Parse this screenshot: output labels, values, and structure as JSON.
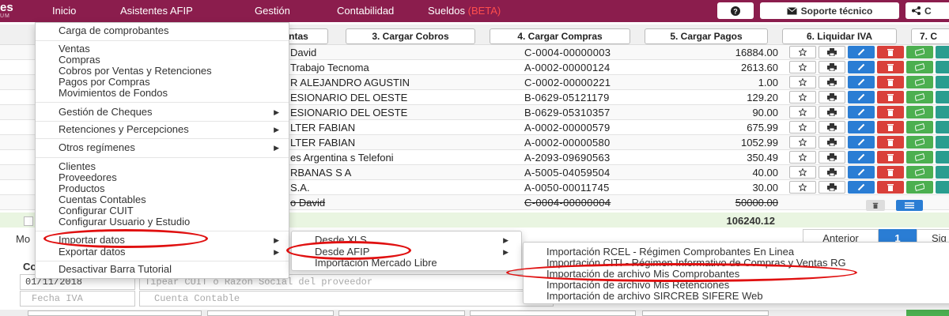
{
  "brand": {
    "main": "es",
    "sub": "UM"
  },
  "nav": {
    "items": [
      {
        "label": "Inicio"
      },
      {
        "label": "Asistentes AFIP"
      },
      {
        "label": "Gestión"
      },
      {
        "label": "Contabilidad"
      },
      {
        "label": "Sueldos"
      }
    ],
    "beta": "(BETA)",
    "support_label": "Soporte técnico",
    "share_label": "C"
  },
  "steps": [
    {
      "label": "ntas"
    },
    {
      "label": "3. Cargar Cobros"
    },
    {
      "label": "4. Cargar Compras"
    },
    {
      "label": "5. Cargar Pagos"
    },
    {
      "label": "6. Liquidar IVA"
    },
    {
      "label": "7. C"
    }
  ],
  "table": {
    "rows": [
      {
        "name": "David",
        "comprobante": "C-0004-00000003",
        "amount": "16884.00"
      },
      {
        "name": "Trabajo Tecnoma",
        "comprobante": "A-0002-00000124",
        "amount": "2613.60"
      },
      {
        "name": "R ALEJANDRO AGUSTIN",
        "comprobante": "C-0002-00000221",
        "amount": "1.00"
      },
      {
        "name": "ESIONARIO DEL OESTE",
        "comprobante": "B-0629-05121179",
        "amount": "129.20"
      },
      {
        "name": "ESIONARIO DEL OESTE",
        "comprobante": "B-0629-05310357",
        "amount": "90.00"
      },
      {
        "name": "LTER FABIAN",
        "comprobante": "A-0002-00000579",
        "amount": "675.99"
      },
      {
        "name": "LTER FABIAN",
        "comprobante": "A-0002-00000580",
        "amount": "1052.99"
      },
      {
        "name": "es Argentina s Telefoni",
        "comprobante": "A-2093-09690563",
        "amount": "350.49"
      },
      {
        "name": "RBANAS S A",
        "comprobante": "A-5005-04059504",
        "amount": "40.00"
      },
      {
        "name": "S.A.",
        "comprobante": "A-0050-00011745",
        "amount": "30.00"
      },
      {
        "name": "o David",
        "comprobante": "C-0004-00000004",
        "amount": "50000.00"
      }
    ],
    "total": "106240.12"
  },
  "pagination": {
    "prev": "Anterior",
    "current": "1",
    "next": "Sig"
  },
  "mo_label": "Mo",
  "form": {
    "label_c": "Co",
    "date_value": "01/11/2018",
    "provider_placeholder": "Tipear CUIT o Razón Social del proveedor",
    "fecha_iva_placeholder": "Fecha IVA",
    "cuenta_placeholder": "Cuenta Contable"
  },
  "menu1": {
    "items": [
      {
        "label": "Carga de comprobantes"
      },
      {
        "label": "Ventas"
      },
      {
        "label": "Compras"
      },
      {
        "label": "Cobros por Ventas y Retenciones"
      },
      {
        "label": "Pagos por Compras"
      },
      {
        "label": "Movimientos de Fondos"
      },
      {
        "label": "Gestión de Cheques"
      },
      {
        "label": "Retenciones y Percepciones"
      },
      {
        "label": "Otros regímenes"
      },
      {
        "label": "Clientes"
      },
      {
        "label": "Proveedores"
      },
      {
        "label": "Productos"
      },
      {
        "label": "Cuentas Contables"
      },
      {
        "label": "Configurar CUIT"
      },
      {
        "label": "Configurar Usuario y Estudio"
      },
      {
        "label": "Importar datos"
      },
      {
        "label": "Exportar datos"
      },
      {
        "label": "Desactivar Barra Tutorial"
      }
    ]
  },
  "menu2": {
    "items": [
      {
        "label": "Desde XLS"
      },
      {
        "label": "Desde AFIP"
      },
      {
        "label": "Importación Mercado Libre"
      }
    ]
  },
  "menu3": {
    "items": [
      {
        "label": "Importación RCEL - Régimen Comprobantes En Linea"
      },
      {
        "label": "Importación CITI - Régimen Informativo de Compras y Ventas RG"
      },
      {
        "label": "Importación de archivo Mis Comprobantes"
      },
      {
        "label": "Importación de archivo Mis Retenciones"
      },
      {
        "label": "Importación de archivo SIRCREB SIFERE Web"
      }
    ]
  },
  "colors": {
    "navbar": "#8b1d4d",
    "beta": "#ff4d4d",
    "edit": "#2a7dd4",
    "delete": "#d9403a",
    "ok": "#4caf50",
    "highlight": "#e01010"
  }
}
